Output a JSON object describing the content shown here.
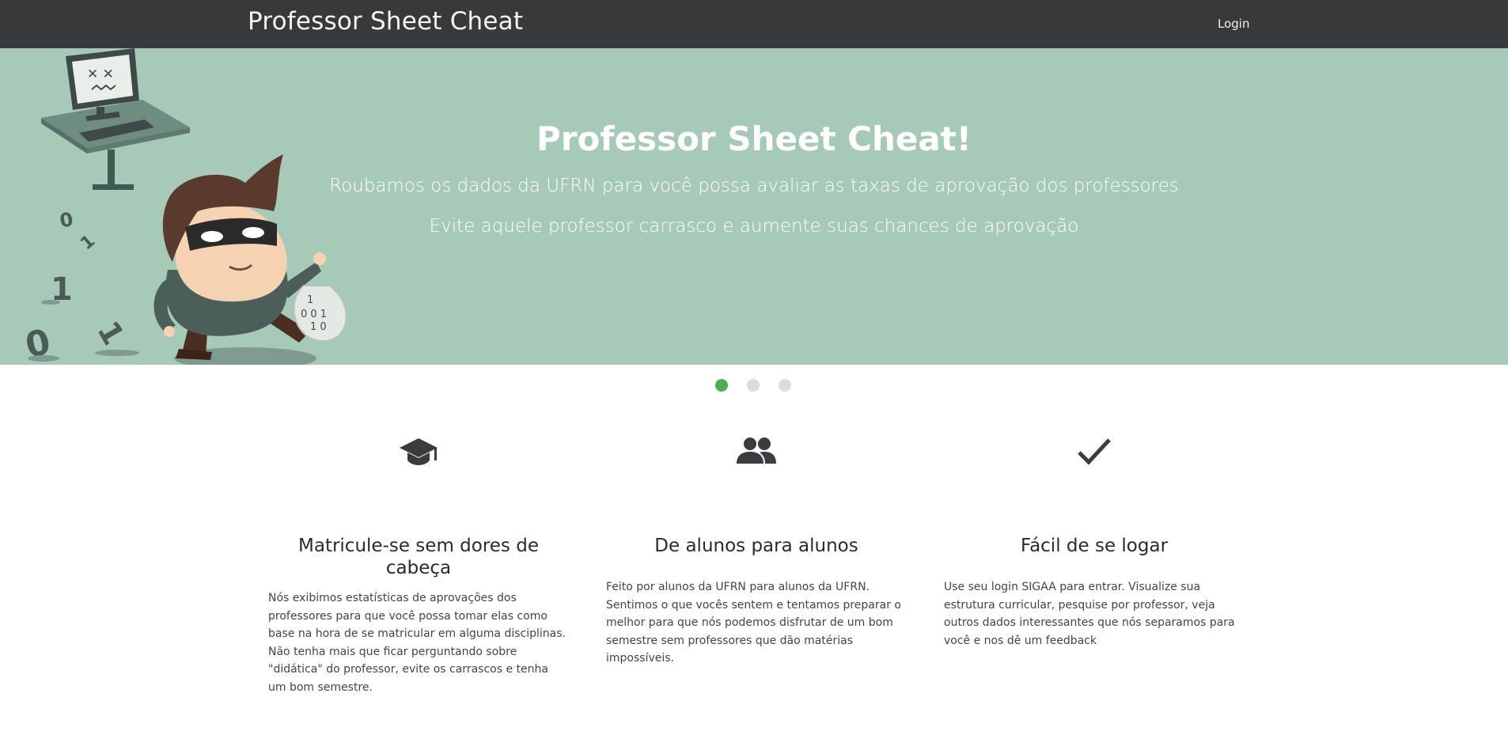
{
  "navbar": {
    "brand": "Professor Sheet Cheat",
    "login_label": "Login"
  },
  "hero": {
    "title": "Professor Sheet Cheat!",
    "line1": "Roubamos os dados da UFRN para você possa avaliar as taxas de aprovação dos professores",
    "line2": "Evite aquele professor carrasco e aumente suas chances de aprovação",
    "illustration": "thief-with-computer-illustration",
    "background": "#a7c9b8"
  },
  "carousel": {
    "slides": 3,
    "active_index": 0,
    "active_color": "#4caf50"
  },
  "features": [
    {
      "icon": "graduation-cap-icon",
      "title": "Matricule-se sem dores de cabeça",
      "text": "Nós exibimos estatísticas de aprovações dos professores para que você possa tomar elas como base na hora de se matricular em alguma disciplinas. Não tenha mais que ficar perguntando sobre \"didática\" do professor, evite os carrascos e tenha um bom semestre."
    },
    {
      "icon": "users-icon",
      "title": "De alunos para alunos",
      "text": "Feito por alunos da UFRN para alunos da UFRN. Sentimos o que vocês sentem e tentamos preparar o melhor para que nós podemos disfrutar de um bom semestre sem professores que dão matérias impossíveis."
    },
    {
      "icon": "check-icon",
      "title": "Fácil de se logar",
      "text": "Use seu login SIGAA para entrar. Visualize sua estrutura curricular, pesquise por professor, veja outros dados interessantes que nós separamos para você e nos dê um feedback"
    }
  ]
}
